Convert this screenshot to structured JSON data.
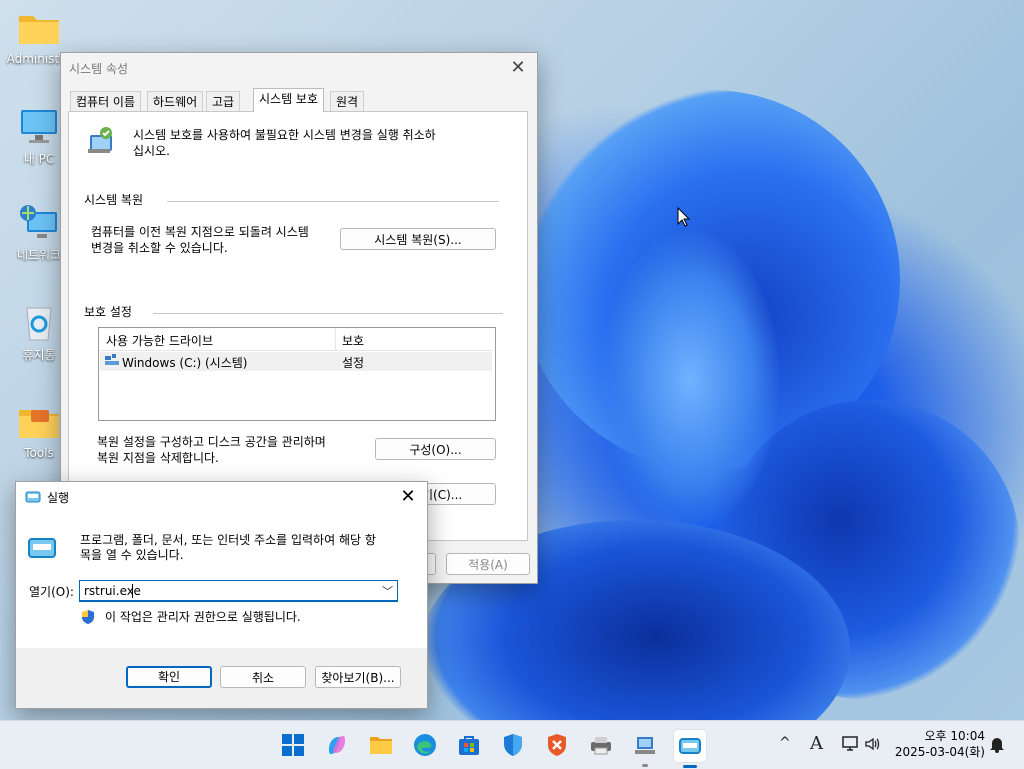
{
  "desktop": {
    "icons": [
      {
        "label": "Administra",
        "icon": "folder-icon"
      },
      {
        "label": "내 PC",
        "icon": "monitor-icon"
      },
      {
        "label": "네트워크",
        "icon": "network-icon"
      },
      {
        "label": "휴지통",
        "icon": "recycle-bin-icon"
      },
      {
        "label": "Tools",
        "icon": "tools-folder-icon"
      }
    ]
  },
  "sysprops": {
    "title": "시스템 속성",
    "tabs": [
      "컴퓨터 이름",
      "하드웨어",
      "고급",
      "시스템 보호",
      "원격"
    ],
    "active_tab": "시스템 보호",
    "intro_line1": "시스템 보호를 사용하여 불필요한 시스템 변경을 실행 취소하",
    "intro_line2": "십시오.",
    "restore_section": "시스템 복원",
    "restore_desc_line1": "컴퓨터를 이전 복원 지점으로 되돌려 시스템",
    "restore_desc_line2": "변경을 취소할 수 있습니다.",
    "restore_button": "시스템 복원(S)...",
    "protect_section": "보호 설정",
    "table_headers": [
      "사용 가능한 드라이브",
      "보호"
    ],
    "table_rows": [
      {
        "drive": "Windows (C:) (시스템)",
        "protection": "설정"
      }
    ],
    "config_desc_line1": "복원 설정을 구성하고 디스크 공간을 관리하며",
    "config_desc_line2": "복원 지점을 삭제합니다.",
    "config_button": "구성(O)...",
    "create_button_partial": "기(C)...",
    "apply_button": "적용(A)"
  },
  "run": {
    "title": "실행",
    "desc_line1": "프로그램, 폴더, 문서, 또는 인터넷 주소를 입력하여 해당 항",
    "desc_line2": "목을 열 수 있습니다.",
    "open_label": "열기(O):",
    "open_value": "rstrui.exe",
    "admin_note": "이 작업은 관리자 권한으로 실행됩니다.",
    "ok_button": "확인",
    "cancel_button": "취소",
    "browse_button": "찾아보기(B)..."
  },
  "taskbar": {
    "apps": [
      "start-icon",
      "copilot-icon",
      "file-explorer-icon",
      "edge-icon",
      "store-icon",
      "defender-icon",
      "office-icon",
      "printer-icon",
      "system-properties-icon",
      "run-icon"
    ],
    "tray_chevron": "^",
    "ime": "A",
    "clock_time": "오후 10:04",
    "clock_date": "2025-03-04(화)"
  },
  "colors": {
    "accent": "#0067c0",
    "taskbar": "#e9eef5",
    "wallpaper_blue": "#1d5ee8"
  }
}
